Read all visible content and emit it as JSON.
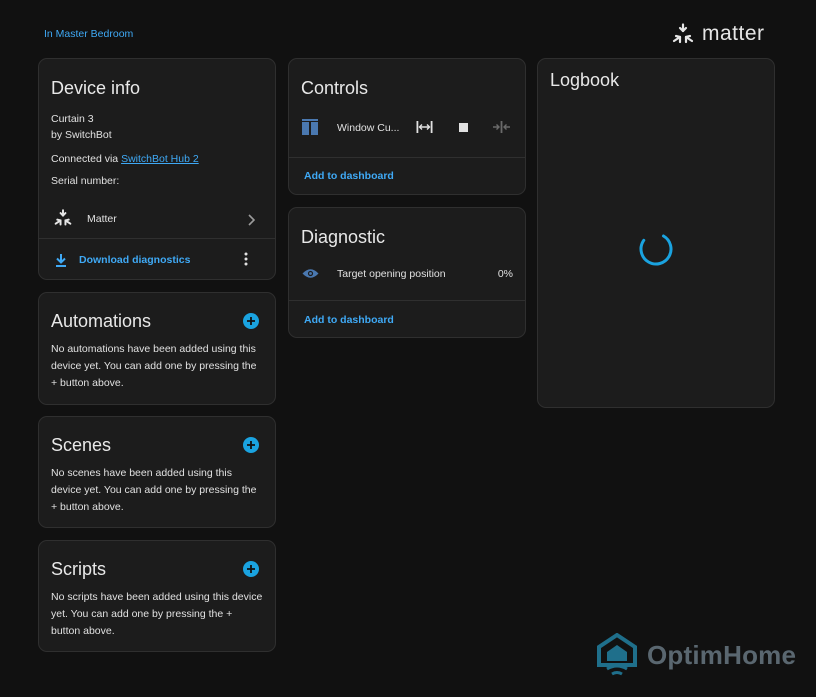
{
  "breadcrumb": {
    "area": "In Master Bedroom"
  },
  "brand": {
    "name": "matter"
  },
  "device_info": {
    "title": "Device info",
    "model": "Curtain 3",
    "manufacturer": "by SwitchBot",
    "connected_prefix": "Connected via",
    "connected_link": "SwitchBot Hub 2",
    "serial_label": "Serial number:",
    "integration": "Matter",
    "download_label": "Download diagnostics"
  },
  "automations": {
    "title": "Automations",
    "text": "No automations have been added using this device yet. You can add one by pressing the + button above."
  },
  "scenes": {
    "title": "Scenes",
    "text": "No scenes have been added using this device yet. You can add one by pressing the + button above."
  },
  "scripts": {
    "title": "Scripts",
    "text": "No scripts have been added using this device yet. You can add one by pressing the + button above."
  },
  "controls": {
    "title": "Controls",
    "entity_name": "Window Cu...",
    "add_label": "Add to dashboard"
  },
  "diagnostic": {
    "title": "Diagnostic",
    "entity_name": "Target opening position",
    "entity_value": "0%",
    "add_label": "Add to dashboard"
  },
  "logbook": {
    "title": "Logbook"
  },
  "watermark": {
    "text": "OptimHome"
  },
  "colors": {
    "background": "#111111",
    "card": "#1c1c1c",
    "accent": "#3fa9f5",
    "spinner": "#1aa3e0",
    "watermark": "#5a6770"
  }
}
